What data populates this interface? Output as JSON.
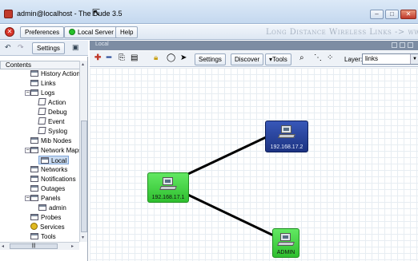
{
  "window": {
    "title": "admin@localhost - The Dude 3.5",
    "minimize": "–",
    "maximize": "□",
    "close": "✕"
  },
  "menu": {
    "close_icon": "✕",
    "preferences": "Preferences",
    "local_server": "Local Server",
    "help": "Help",
    "banner": "Long Distance Wireless Links -> www"
  },
  "left_toolbar": {
    "back_glyph": "↶",
    "forward_glyph": "↷",
    "settings": "Settings"
  },
  "map_tab": {
    "label": "Local"
  },
  "map_toolbar": {
    "add": "✚",
    "remove": "━",
    "settings": "Settings",
    "discover": "Discover",
    "tools": "▾Tools",
    "layer_label": "Layer:",
    "layer_value": "links",
    "select_arrow": "▼"
  },
  "tree": {
    "header": "Contents",
    "items": [
      {
        "label": "History Actions"
      },
      {
        "label": "Links"
      },
      {
        "label": "Logs"
      },
      {
        "label": "Action"
      },
      {
        "label": "Debug"
      },
      {
        "label": "Event"
      },
      {
        "label": "Syslog"
      },
      {
        "label": "Mib Nodes"
      },
      {
        "label": "Network Maps"
      },
      {
        "label": "Local"
      },
      {
        "label": "Networks"
      },
      {
        "label": "Notifications"
      },
      {
        "label": "Outages"
      },
      {
        "label": "Panels"
      },
      {
        "label": "admin"
      },
      {
        "label": "Probes"
      },
      {
        "label": "Services"
      },
      {
        "label": "Tools"
      }
    ],
    "expander_minus": "−",
    "scroll_left": "◂",
    "scroll_right": "▸",
    "scroll_up": "▴",
    "scroll_down": "▾",
    "grip": "|||"
  },
  "nodes": [
    {
      "label": "192.168.17.1",
      "color": "#3fd13f"
    },
    {
      "label": "192.168.17.2",
      "color": "#23398e"
    },
    {
      "label": "ADMIN",
      "color": "#3fd13f"
    }
  ],
  "colors": {
    "link": "#000000",
    "selection": "#c9dbf1",
    "status_up": "#3fd13f"
  }
}
